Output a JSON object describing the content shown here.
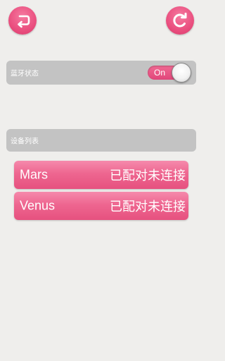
{
  "header": {
    "back_icon": "back-arrow-icon",
    "refresh_icon": "refresh-icon"
  },
  "bluetooth": {
    "label": "蓝牙状态",
    "toggle_text": "On"
  },
  "device_list": {
    "header": "设备列表",
    "items": [
      {
        "name": "Mars",
        "status": "已配对未连接"
      },
      {
        "name": "Venus",
        "status": "已配对未连接"
      }
    ]
  },
  "colors": {
    "accent": "#ea4f7f",
    "background": "#efeeec",
    "bar_gray": "#c3c3c3"
  }
}
